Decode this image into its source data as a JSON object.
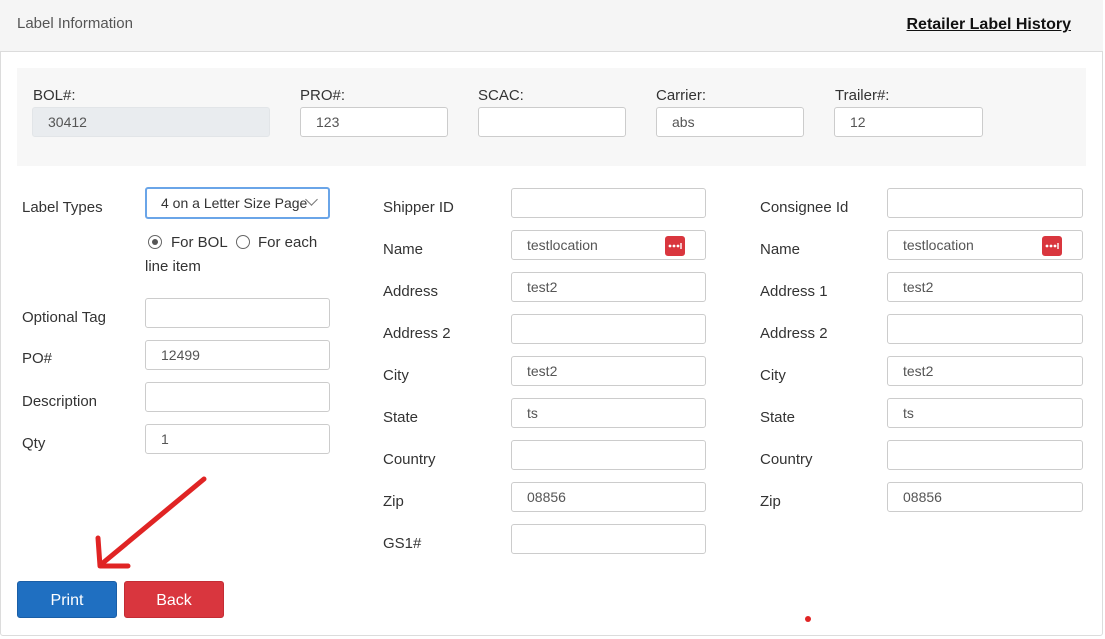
{
  "header": {
    "title": "Label Information",
    "history_link": "Retailer Label History"
  },
  "top": {
    "bol_label": "BOL#:",
    "bol_value": "30412",
    "pro_label": "PRO#:",
    "pro_value": "123",
    "scac_label": "SCAC:",
    "scac_value": "",
    "carrier_label": "Carrier:",
    "carrier_value": "abs",
    "trailer_label": "Trailer#:",
    "trailer_value": "12"
  },
  "left": {
    "label_types_label": "Label Types",
    "label_types_value": "4 on a Letter Size Page",
    "radio_bol_label": "For BOL",
    "radio_bol_checked": true,
    "radio_each_label": "For each",
    "radio_each_label2": "line item",
    "optional_tag_label": "Optional Tag",
    "optional_tag_value": "",
    "po_label": "PO#",
    "po_value": "12499",
    "description_label": "Description",
    "description_value": "",
    "qty_label": "Qty",
    "qty_value": "1"
  },
  "shipper": {
    "id_label": "Shipper ID",
    "id_value": "",
    "name_label": "Name",
    "name_value": "testlocation",
    "address_label": "Address",
    "address_value": "test2",
    "address2_label": "Address 2",
    "address2_value": "",
    "city_label": "City",
    "city_value": "test2",
    "state_label": "State",
    "state_value": "ts",
    "country_label": "Country",
    "country_value": "",
    "zip_label": "Zip",
    "zip_value": "08856",
    "gs1_label": "GS1#",
    "gs1_value": ""
  },
  "consignee": {
    "id_label": "Consignee Id",
    "id_value": "",
    "name_label": "Name",
    "name_value": "testlocation",
    "address1_label": "Address 1",
    "address1_value": "test2",
    "address2_label": "Address 2",
    "address2_value": "",
    "city_label": "City",
    "city_value": "test2",
    "state_label": "State",
    "state_value": "ts",
    "country_label": "Country",
    "country_value": "",
    "zip_label": "Zip",
    "zip_value": "08856"
  },
  "actions": {
    "print_label": "Print",
    "back_label": "Back"
  },
  "colors": {
    "print_button": "#1f6fc1",
    "back_button": "#d9363e",
    "annotation_arrow": "#e02424"
  },
  "icons": {
    "name_lookup": "more-dots-icon",
    "select_chevron": "chevron-down-icon",
    "annotation": "red-arrow-icon"
  }
}
